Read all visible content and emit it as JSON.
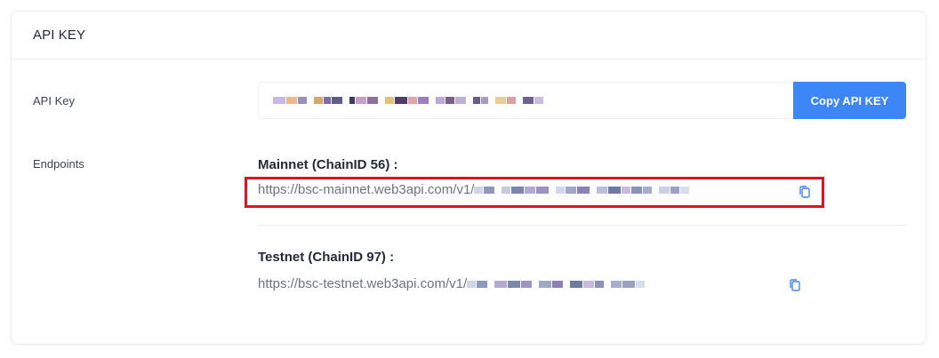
{
  "card": {
    "title": "API KEY"
  },
  "api_key": {
    "label": "API Key",
    "copy_button": "Copy API KEY"
  },
  "endpoints": {
    "label": "Endpoints",
    "mainnet": {
      "title": "Mainnet (ChainID 56) :",
      "url_prefix": "https://bsc-mainnet.web3api.com/v1/"
    },
    "testnet": {
      "title": "Testnet (ChainID 97) :",
      "url_prefix": "https://bsc-testnet.web3api.com/v1/"
    }
  },
  "colors": {
    "accent": "#3d86f7",
    "highlight": "#e0141e",
    "copy_icon": "#3d86f7"
  },
  "icons": {
    "copy": "copy-icon"
  }
}
